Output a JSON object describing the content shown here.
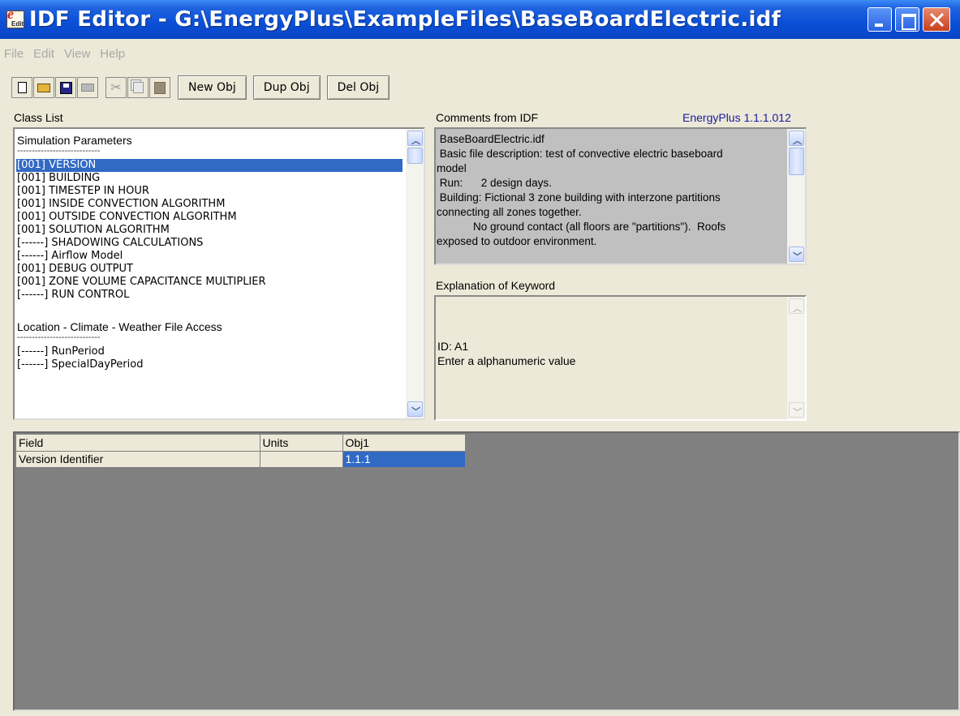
{
  "window": {
    "title": "IDF Editor - G:\\EnergyPlus\\ExampleFiles\\BaseBoardElectric.idf",
    "icon_letter": "e",
    "icon_sub": "Edit"
  },
  "menu": [
    "File",
    "Edit",
    "View",
    "Help"
  ],
  "toolbar": {
    "icons": [
      "new-file",
      "open-folder",
      "save-disk",
      "print",
      "cut-scissors",
      "copy",
      "paste"
    ],
    "new_obj": "New Obj",
    "dup_obj": "Dup Obj",
    "del_obj": "Del Obj"
  },
  "class_list": {
    "label": "Class List",
    "rows": [
      {
        "text": "Simulation Parameters",
        "kind": "heading"
      },
      {
        "text": "----------------------------",
        "kind": "dash"
      },
      {
        "text": "[001]  VERSION",
        "kind": "item",
        "selected": true
      },
      {
        "text": "[001]  BUILDING",
        "kind": "item"
      },
      {
        "text": "[001]  TIMESTEP IN HOUR",
        "kind": "item"
      },
      {
        "text": "[001]  INSIDE CONVECTION ALGORITHM",
        "kind": "item"
      },
      {
        "text": "[001]  OUTSIDE CONVECTION ALGORITHM",
        "kind": "item"
      },
      {
        "text": "[001]  SOLUTION ALGORITHM",
        "kind": "item"
      },
      {
        "text": "[------]  SHADOWING CALCULATIONS",
        "kind": "item"
      },
      {
        "text": "[------]  Airflow Model",
        "kind": "item"
      },
      {
        "text": "[001]  DEBUG OUTPUT",
        "kind": "item"
      },
      {
        "text": "[001]  ZONE VOLUME CAPACITANCE MULTIPLIER",
        "kind": "item"
      },
      {
        "text": "[------]  RUN CONTROL",
        "kind": "item"
      },
      {
        "text": "",
        "kind": "gap"
      },
      {
        "text": "Location - Climate - Weather File Access",
        "kind": "heading"
      },
      {
        "text": "----------------------------",
        "kind": "dash"
      },
      {
        "text": "[------]  RunPeriod",
        "kind": "item"
      },
      {
        "text": "[------]  SpecialDayPeriod",
        "kind": "item"
      }
    ]
  },
  "comments": {
    "label": "Comments from IDF",
    "version": "EnergyPlus 1.1.1.012",
    "lines": [
      " BaseBoardElectric.idf",
      " Basic file description: test of convective electric baseboard",
      "model",
      " Run:      2 design days.",
      " Building: Fictional 3 zone building with interzone partitions",
      "connecting all zones together.",
      "            No ground contact (all floors are \"partitions\").  Roofs",
      "exposed to outdoor environment."
    ]
  },
  "explanation": {
    "label": "Explanation of Keyword",
    "lines": [
      "ID: A1",
      "Enter a alphanumeric value"
    ]
  },
  "grid": {
    "headers": [
      "Field",
      "Units",
      "Obj1"
    ],
    "rows": [
      [
        "Version Identifier",
        "",
        "1.1.1"
      ]
    ]
  }
}
